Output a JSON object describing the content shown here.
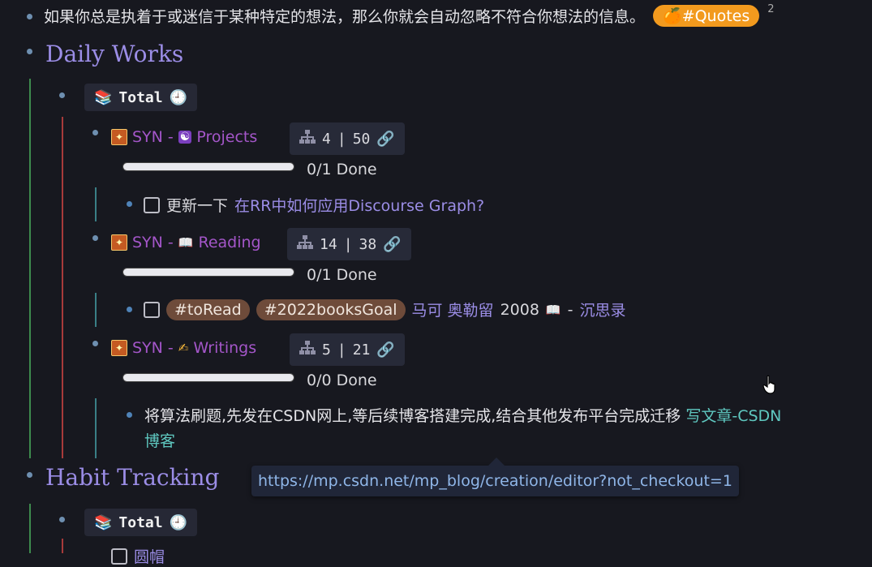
{
  "quote": {
    "text": "如果你总是执着于或迷信于某种特定的想法，那么你就会自动忽略不符合你想法的信息。",
    "tag": "🍊#Quotes",
    "ref_count": "2"
  },
  "sections": {
    "daily": {
      "title": "Daily Works",
      "total_label": "Total",
      "syns": [
        {
          "prefix": "SYN - ",
          "icon": "☯",
          "name": "Projects",
          "stat_a": "4",
          "sep": "|",
          "stat_b": "50",
          "progress_text": "0/1 Done",
          "progress": 0
        },
        {
          "prefix": "SYN - ",
          "icon": "📖",
          "name": "Reading",
          "stat_a": "14",
          "sep": "|",
          "stat_b": "38",
          "progress_text": "0/1 Done",
          "progress": 0
        },
        {
          "prefix": "SYN - ",
          "icon": "✍",
          "name": "Writings",
          "stat_a": "5",
          "sep": "|",
          "stat_b": "21",
          "progress_text": "0/0 Done",
          "progress": 0
        }
      ],
      "tasks": {
        "projects": {
          "text": "更新一下",
          "link": "在RR中如何应用Discourse Graph?"
        },
        "reading": {
          "tags": [
            "#toRead",
            "#2022booksGoal"
          ],
          "author": "马可 奥勒留",
          "year": "2008",
          "book_icon": "📖",
          "dash": "-",
          "title": "沉思录"
        },
        "writing": {
          "text_line1": "将算法刷题,先发在CSDN网上,等后续博客搭建完成,结合其他发布平台完成迁移",
          "link_part1": "写文章-CSDN",
          "link_part2": "博客"
        }
      }
    },
    "habit": {
      "title": "Habit Tracking",
      "total_label": "Total",
      "next_item": "圆帽"
    }
  },
  "tooltip": {
    "url": "https://mp.csdn.net/mp_blog/creation/editor?not_checkout=1"
  },
  "icons": {
    "books": "books-icon",
    "clock": "clock-icon",
    "tree": "hierarchy-icon",
    "link": "link-icon",
    "cursor": "hand-cursor-icon"
  }
}
